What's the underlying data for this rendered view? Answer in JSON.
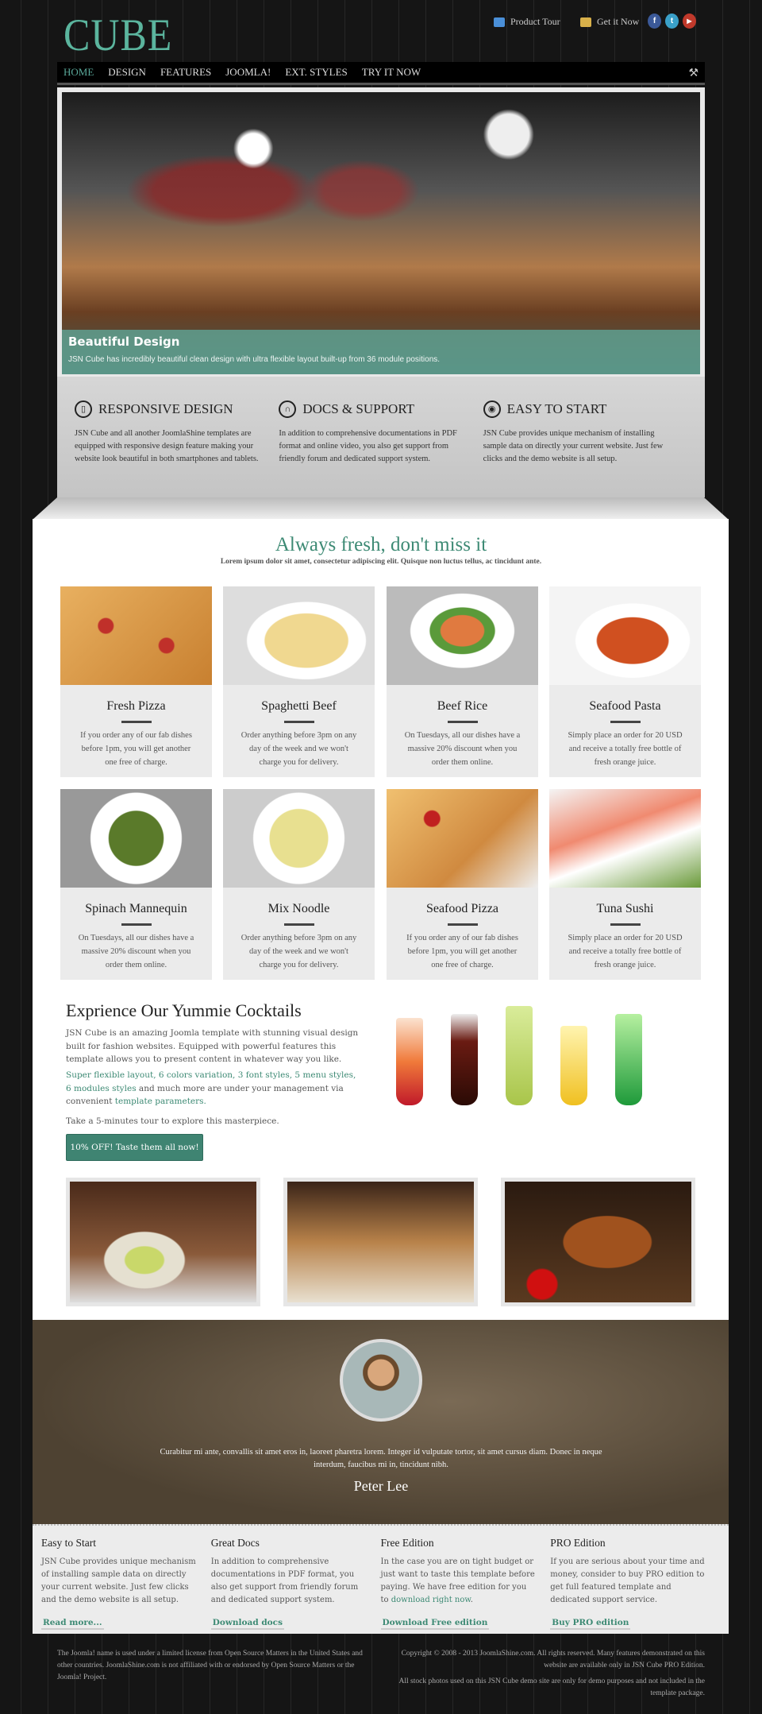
{
  "header": {
    "logo": "CUBE",
    "links": [
      {
        "label": "Product Tour",
        "icon": "monitor-icon"
      },
      {
        "label": "Get it Now",
        "icon": "download-folder-icon"
      }
    ],
    "social": [
      {
        "icon": "facebook-icon",
        "glyph": "f",
        "color": "#3b5998"
      },
      {
        "icon": "twitter-icon",
        "glyph": "t",
        "color": "#3aa0c8"
      },
      {
        "icon": "youtube-icon",
        "glyph": "▶",
        "color": "#c0392b"
      }
    ]
  },
  "nav": {
    "items": [
      "HOME",
      "DESIGN",
      "FEATURES",
      "JOOMLA!",
      "EXT. STYLES",
      "TRY IT NOW"
    ],
    "active": "HOME"
  },
  "slider": {
    "title": "Beautiful Design",
    "text": "JSN Cube has incredibly beautiful clean design with ultra flexible layout built-up from 36 module positions."
  },
  "features": [
    {
      "title": "RESPONSIVE DESIGN",
      "icon": "mobile-icon",
      "text": "JSN Cube and all another JoomlaShine templates are equipped with responsive design feature making your website look beautiful in both smartphones and tablets."
    },
    {
      "title": "DOCS & SUPPORT",
      "icon": "headset-icon",
      "text": "In addition to comprehensive documentations in PDF format and online video, you also get support from friendly forum and dedicated support system."
    },
    {
      "title": "EASY TO START",
      "icon": "power-icon",
      "text": "JSN Cube provides unique mechanism of installing sample data on directly your current website. Just few clicks and the demo website is all setup."
    }
  ],
  "fresh": {
    "title": "Always fresh, don't miss it",
    "subtitle": "Lorem ipsum dolor sit amet, consectetur adipiscing elit. Quisque non luctus tellus, ac tincidunt ante.",
    "dishes": [
      {
        "name": "Fresh Pizza",
        "text": "If you order any of our fab dishes before 1pm, you will get another one free of charge."
      },
      {
        "name": "Spaghetti Beef",
        "text": "Order anything before 3pm on any day of the week and we won't charge you for delivery."
      },
      {
        "name": "Beef Rice",
        "text": "On Tuesdays, all our dishes have a massive 20% discount when you order them online."
      },
      {
        "name": "Seafood Pasta",
        "text": "Simply place an order for 20 USD and receive a totally free bottle of fresh orange juice."
      },
      {
        "name": "Spinach Mannequin",
        "text": "On Tuesdays, all our dishes have a massive 20% discount when you order them online."
      },
      {
        "name": "Mix Noodle",
        "text": "Order anything before 3pm on any day of the week and we won't charge you for delivery."
      },
      {
        "name": "Seafood Pizza",
        "text": "If you order any of our fab dishes before 1pm, you will get another one free of charge."
      },
      {
        "name": "Tuna Sushi",
        "text": "Simply place an order for 20 USD and receive a totally free bottle of fresh orange juice."
      }
    ]
  },
  "cocktails": {
    "title": "Exprience Our Yummie Cocktails",
    "p1": "JSN Cube is an amazing Joomla template with stunning visual design built for fashion websites. Equipped with powerful features this template allows you to present content in whatever way you like.",
    "p2_link1": "Super flexible layout, 6 colors variation, 3 font styles, 5 menu styles, 6 modules styles",
    "p2_mid": " and much more are under your management via convenient ",
    "p2_link2": "template parameters.",
    "p3": "Take a 5-minutes tour to explore this masterpiece.",
    "button": "10% OFF! Taste them all now!"
  },
  "testimonial": {
    "quote": "Curabitur mi ante, convallis sit amet eros in, laoreet pharetra lorem. Integer id vulputate tortor, sit amet cursus diam. Donec in neque interdum, faucibus mi in, tincidunt nibh.",
    "author": "Peter Lee"
  },
  "bottom": [
    {
      "title": "Easy to Start",
      "text": "JSN Cube provides unique mechanism of installing sample data on directly your current website. Just few clicks and the demo website is all setup.",
      "link": "Read more..."
    },
    {
      "title": "Great Docs",
      "text": "In addition to comprehensive documentations in PDF format, you also get support from friendly forum and dedicated support system.",
      "link": "Download docs"
    },
    {
      "title": "Free Edition",
      "text": "In the case you are on tight budget or just want to taste this template before paying. We have free edition for you to ",
      "text_link": "download right now",
      "text_end": ".",
      "link": "Download Free edition"
    },
    {
      "title": "PRO Edition",
      "text": "If you are serious about your time and money, consider to buy PRO edition to get full featured template and dedicated support service.",
      "link": "Buy PRO edition"
    }
  ],
  "footer": {
    "left": "The Joomla! name is used under a limited license from Open Source Matters in the United States and other countries. JoomlaShine.com is not affiliated with or endorsed by Open Source Matters or the Joomla! Project.",
    "right1": "Copyright © 2008 - 2013 JoomlaShine.com. All rights reserved. Many features demonstrated on this website are available only in JSN Cube PRO Edition.",
    "right2": "All stock photos used on this JSN Cube demo site are only for demo purposes and not included in the template package."
  },
  "colors": {
    "accent": "#3d8a74",
    "logo": "#5bb59e",
    "button": "#3f8472"
  }
}
